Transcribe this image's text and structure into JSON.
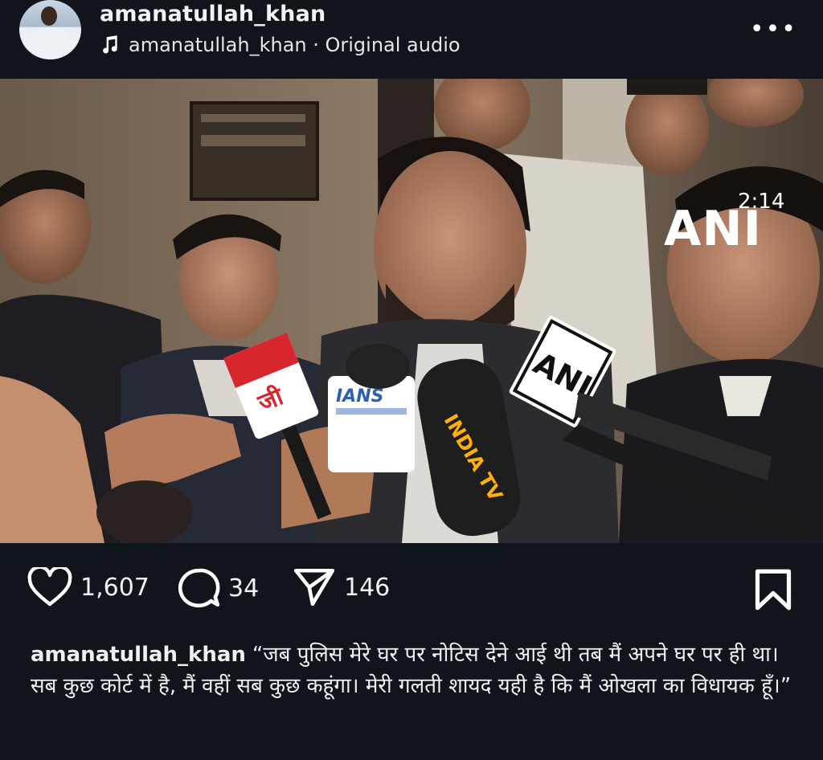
{
  "header": {
    "username": "amanatullah_khan",
    "audio_label": "amanatullah_khan · Original audio",
    "icons": {
      "music": "music-note-icon",
      "more": "more-options-icon"
    }
  },
  "video": {
    "timestamp": "2:14",
    "watermark": "ANI",
    "mic_labels": [
      "IANS",
      "INDIA TV",
      "ANI"
    ],
    "muted": true
  },
  "actions": {
    "likes": "1,607",
    "comments": "34",
    "shares": "146",
    "icons": {
      "like": "heart-icon",
      "comment": "comment-bubble-icon",
      "share": "paper-plane-icon",
      "save": "bookmark-icon"
    }
  },
  "caption": {
    "username": "amanatullah_khan",
    "text": "“जब पुलिस मेरे घर पर नोटिस देने आई थी तब मैं अपने घर पर ही था। सब कुछ कोर्ट में है, मैं वहीं सब कुछ कहूंगा। मेरी गलती शायद यही है कि मैं ओखला का विधायक हूँ।”"
  },
  "colors": {
    "background": "#10141b",
    "text": "#f2f2f2",
    "accent_red": "#d8262e"
  }
}
